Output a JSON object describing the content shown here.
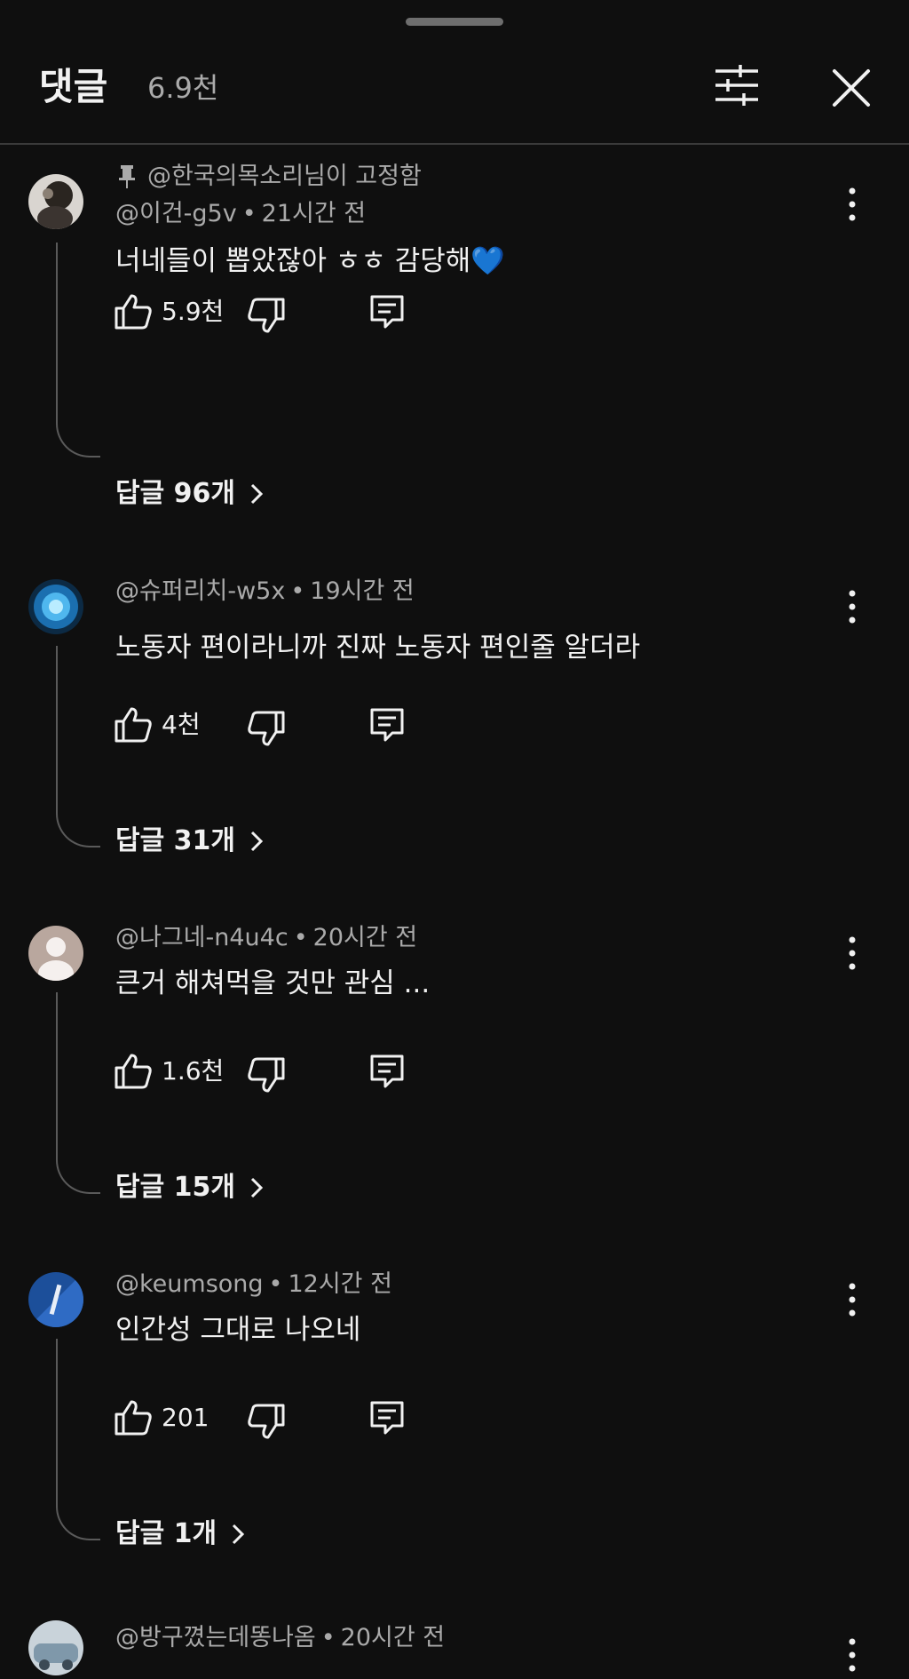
{
  "header": {
    "title": "댓글",
    "count": "6.9천",
    "filter_icon": "sliders-icon",
    "close_icon": "close-icon"
  },
  "comments": [
    {
      "pinned_label": "@한국의목소리님이 고정함",
      "author": "@이건-g5v",
      "time": "21시간 전",
      "text": "너네들이 뽑았잖아 ㅎㅎ 감당해💙",
      "likes": "5.9천",
      "replies": "답글 96개"
    },
    {
      "author": "@슈퍼리치-w5x",
      "time": "19시간 전",
      "text": "노동자 편이라니까 진짜 노동자 편인줄 알더라",
      "likes": "4천",
      "replies": "답글 31개"
    },
    {
      "author": "@나그네-n4u4c",
      "time": "20시간 전",
      "text": "큰거 해쳐먹을 것만 관심 ...",
      "likes": "1.6천",
      "replies": "답글 15개"
    },
    {
      "author": "@keumsong",
      "time": "12시간 전",
      "text": "인간성 그대로 나오네",
      "likes": "201",
      "replies": "답글 1개"
    },
    {
      "author": "@방구꼈는데똥나옴",
      "time": "20시간 전"
    }
  ],
  "colors": {
    "background": "#0f0f0f",
    "primary_text": "#f1f1f1",
    "secondary_text": "#aaaaaa",
    "thread_line": "#5a5a5a"
  }
}
